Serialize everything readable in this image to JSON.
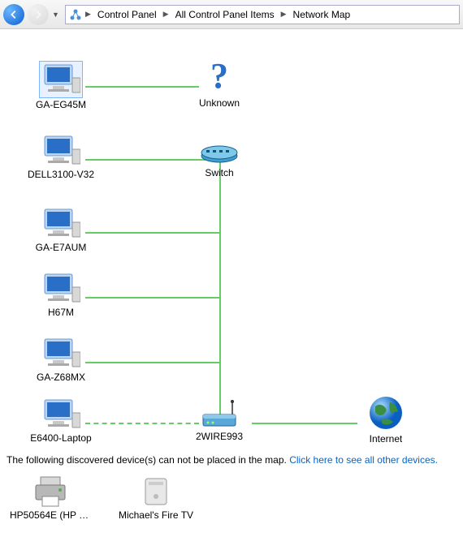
{
  "breadcrumb": {
    "items": [
      "Control Panel",
      "All Control Panel Items",
      "Network Map"
    ]
  },
  "nodes": {
    "ga_eg45m": "GA-EG45M",
    "unknown": "Unknown",
    "dell3100": "DELL3100-V32",
    "switch": "Switch",
    "ga_e7aum": "GA-E7AUM",
    "h67m": "H67M",
    "ga_z68mx": "GA-Z68MX",
    "e6400": "E6400-Laptop",
    "gateway": "2WIRE993",
    "internet": "Internet"
  },
  "footer": {
    "prefix": "The following discovered device(s) can not be placed in the map. ",
    "link": "Click here to see all other devices."
  },
  "unplaced": {
    "printer": "HP50564E (HP Of...",
    "firetv": "Michael's Fire TV"
  }
}
